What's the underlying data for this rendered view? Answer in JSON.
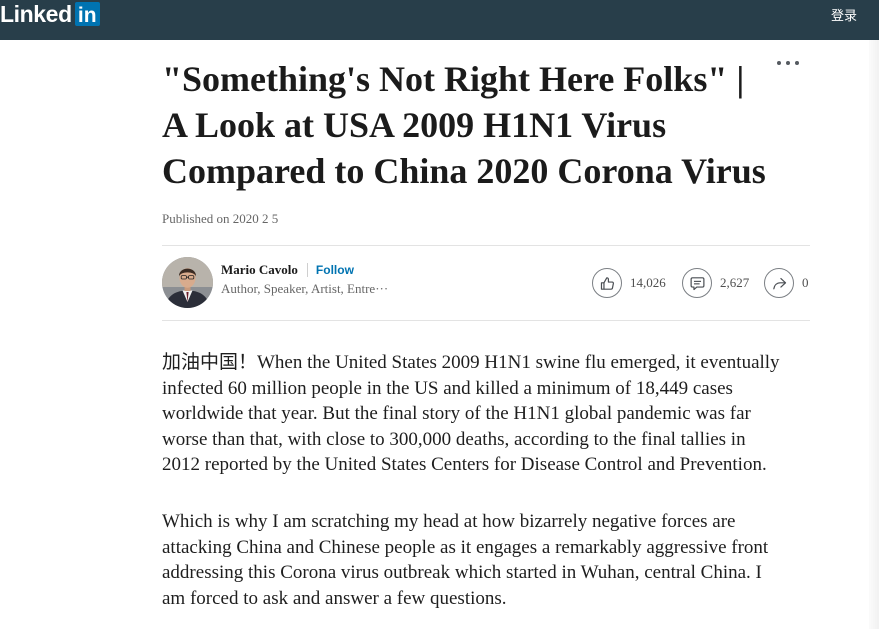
{
  "header": {
    "logo_text": "Linked",
    "logo_badge": "in",
    "login_label": "登录"
  },
  "article": {
    "title_lines": [
      "\"Something's Not Right Here Folks\" |",
      "A Look at USA 2009 H1N1 Virus",
      "Compared to China 2020 Corona Virus"
    ],
    "more_icon": "more-options-icon",
    "published": "Published on 2020 2 5",
    "author": {
      "name": "Mario Cavolo",
      "follow_label": "Follow",
      "headline": "Author, Speaker, Artist, Entre···"
    },
    "social": [
      {
        "icon": "like-icon",
        "count": "14,026"
      },
      {
        "icon": "comment-icon",
        "count": "2,627"
      },
      {
        "icon": "share-icon",
        "count": "0"
      }
    ],
    "paragraphs": [
      {
        "lines": [
          "加油中国！When the United States 2009 H1N1 swine flu emerged, it eventually",
          "infected 60 million people in the US and killed a minimum of 18,449 cases",
          "worldwide that year. But the final story of the H1N1 global pandemic was far",
          "worse than that, with close to 300,000 deaths, according to the final tallies in",
          "2012 reported by the United States Centers for Disease Control and Prevention."
        ]
      },
      {
        "lines": [
          "Which is why I am scratching my head at how bizarrely negative forces are",
          "attacking China and Chinese people as it engages a remarkably aggressive front",
          "addressing this Corona virus outbreak which started in Wuhan, central China. I",
          "am forced to ask and answer a few questions."
        ]
      }
    ]
  },
  "colors": {
    "nav_bg": "#283e4a",
    "brand_blue": "#0073b1",
    "text": "#1d1d1d",
    "muted": "#666666",
    "divider": "#e3e3e3"
  }
}
